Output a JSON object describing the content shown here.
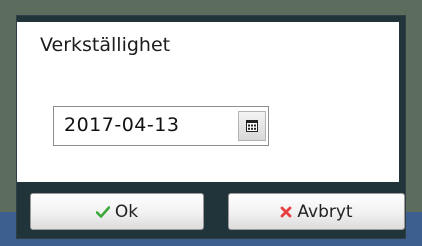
{
  "dialog": {
    "title": "Verkställighet",
    "date_value": "2017-04-13",
    "calendar_icon": "calendar-icon",
    "ok_label": "Ok",
    "cancel_label": "Avbryt",
    "ok_icon": "checkmark-icon",
    "cancel_icon": "cross-icon",
    "colors": {
      "ok_icon": "#3ca83c",
      "cancel_icon": "#e84040"
    }
  }
}
